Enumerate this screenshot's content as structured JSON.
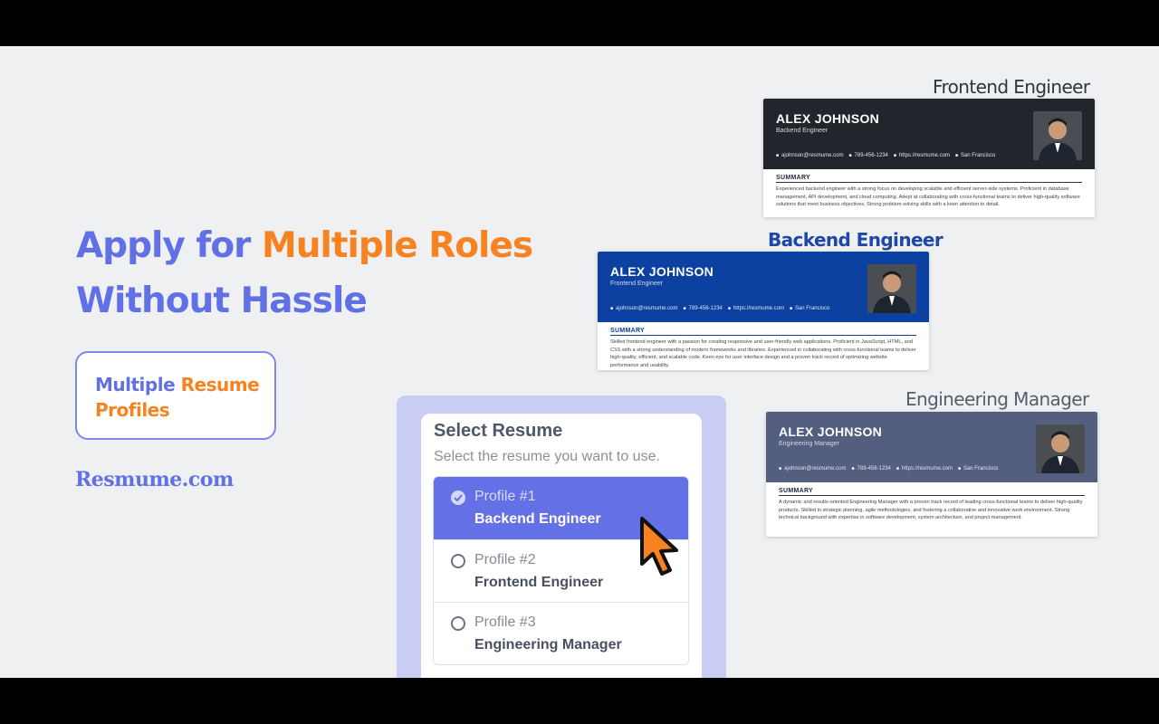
{
  "hero": {
    "headline_part1": "Apply for ",
    "headline_accent": "Multiple Roles",
    "headline_part2": "Without Hassle",
    "pill_part1": "Multiple ",
    "pill_accent": "Resume",
    "pill_part2": "Profiles",
    "brand": "Resmume.com"
  },
  "colors": {
    "brand_purple": "#6270e6",
    "accent_orange": "#f7821f",
    "selected_bg": "#6470e6"
  },
  "select_resume": {
    "title": "Select Resume",
    "subtitle": "Select the resume you want to use.",
    "options": [
      {
        "number": "Profile #1",
        "role": "Backend Engineer",
        "selected": true
      },
      {
        "number": "Profile #2",
        "role": "Frontend Engineer",
        "selected": false
      },
      {
        "number": "Profile #3",
        "role": "Engineering Manager",
        "selected": false
      }
    ]
  },
  "resumes": [
    {
      "label": "Frontend Engineer",
      "name": "ALEX JOHNSON",
      "title": "Backend Engineer",
      "email": "ajohnson@resmume.com",
      "phone": "789-456-1234",
      "website": "https://resmume.com",
      "location": "San Francisco",
      "summary_heading": "SUMMARY",
      "summary": "Experienced backend engineer with a strong focus on developing scalable and efficient server-side systems. Proficient in database management, API development, and cloud computing. Adept at collaborating with cross-functional teams to deliver high-quality software solutions that meet business objectives. Strong problem-solving skills with a keen attention to detail."
    },
    {
      "label": "Backend Engineer",
      "name": "ALEX JOHNSON",
      "title": "Frontend Engineer",
      "email": "ajohnson@resmume.com",
      "phone": "789-456-1234",
      "website": "https://resmume.com",
      "location": "San Francisco",
      "summary_heading": "SUMMARY",
      "summary": "Skilled frontend engineer with a passion for creating responsive and user-friendly web applications. Proficient in JavaScript, HTML, and CSS with a strong understanding of modern frameworks and libraries. Experienced in collaborating with cross-functional teams to deliver high-quality, efficient, and scalable code. Keen eye for user interface design and a proven track record of optimizing website performance and usability."
    },
    {
      "label": "Engineering Manager",
      "name": "ALEX JOHNSON",
      "title": "Engineering Manager",
      "email": "ajohnson@resmume.com",
      "phone": "789-456-1234",
      "website": "https://resmume.com",
      "location": "San Francisco",
      "summary_heading": "SUMMARY",
      "summary": "A dynamic and results-oriented Engineering Manager with a proven track record of leading cross-functional teams to deliver high-quality products. Skilled in strategic planning, agile methodologies, and fostering a collaborative and innovative work environment. Strong technical background with expertise in software development, system architecture, and project management."
    }
  ]
}
